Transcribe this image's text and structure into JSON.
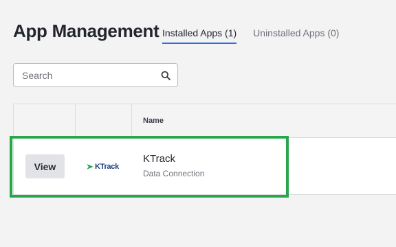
{
  "page": {
    "title": "App Management",
    "tabs": [
      {
        "label": "Installed Apps (1)",
        "active": true
      },
      {
        "label": "Uninstalled Apps (0)",
        "active": false
      }
    ]
  },
  "search": {
    "placeholder": "Search",
    "value": "",
    "icon": "search-icon"
  },
  "table": {
    "columns": [
      "",
      "",
      "Name"
    ],
    "rows": [
      {
        "action_label": "View",
        "logo_text": "KTrack",
        "name": "KTrack",
        "type": "Data Connection"
      }
    ]
  },
  "colors": {
    "highlight": "#27a74a",
    "active_tab_underline": "#2f6fd6",
    "logo_blue": "#1b3f7a",
    "logo_green": "#2fa84f"
  }
}
